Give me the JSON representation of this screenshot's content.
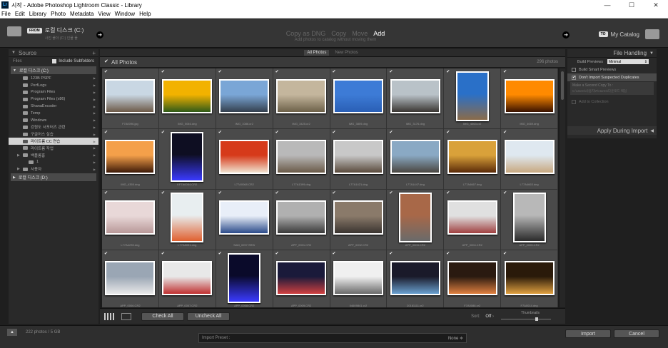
{
  "window": {
    "title": "시작 - Adobe Photoshop Lightroom Classic - Library",
    "app_icon": "Lr",
    "minimize": "—",
    "maximize": "☐",
    "close": "✕"
  },
  "menu": [
    "File",
    "Edit",
    "Library",
    "Photo",
    "Metadata",
    "View",
    "Window",
    "Help"
  ],
  "header": {
    "from_badge": "FROM",
    "source_name": "로컬 디스크 (C:)",
    "source_sub": "사진 폴더 (C:) 인물 폴",
    "modes": [
      "Copy as DNG",
      "Copy",
      "Move",
      "Add"
    ],
    "active_mode": "Add",
    "mode_desc": "Add photos to catalog without moving them",
    "to_badge": "TO",
    "catalog": "My Catalog"
  },
  "source_panel": {
    "title": "Source",
    "plus": "+",
    "files_label": "Files",
    "include_subfolders": "Include Subfolders",
    "volume_c": "로컬 디스크 (C:)",
    "volume_d": "로컬 디스크 (D:)",
    "folders": [
      {
        "name": "123B PSPF",
        "level": 1
      },
      {
        "name": "PerfLogs",
        "level": 1
      },
      {
        "name": "Program Files",
        "level": 1
      },
      {
        "name": "Program Files (x86)",
        "level": 1
      },
      {
        "name": "ShanaEncoder",
        "level": 1
      },
      {
        "name": "Temp",
        "level": 1
      },
      {
        "name": "Windows",
        "level": 1
      },
      {
        "name": "강원도 서포터즈 관련",
        "level": 1
      },
      {
        "name": "구글어스 실습",
        "level": 1
      },
      {
        "name": "라이트룸 CC 연습",
        "level": 1,
        "selected": true
      },
      {
        "name": "라이트룸 작업",
        "level": 1
      },
      {
        "name": "백플롱홍",
        "level": 1
      },
      {
        "name": "1",
        "level": 2
      },
      {
        "name": "사용자",
        "level": 1
      }
    ]
  },
  "grid": {
    "filters": [
      "All Photos",
      "New Photos"
    ],
    "active_filter": "All Photos",
    "title": "All Photos",
    "count": "296 photos",
    "photos": [
      {
        "name": "F7A0096.jpg",
        "orient": "land",
        "colors": [
          "#c9d7e3",
          "#6d5a48"
        ]
      },
      {
        "name": "IMG_0046.dng",
        "orient": "land",
        "colors": [
          "#f2b200",
          "#2f5a18"
        ]
      },
      {
        "name": "IMG_1086.cr2",
        "orient": "land",
        "colors": [
          "#7aa6d6",
          "#34404e"
        ]
      },
      {
        "name": "IMG_3425.cr2",
        "orient": "land",
        "colors": [
          "#c4b69d",
          "#6d6149"
        ]
      },
      {
        "name": "IMG_3809.dng",
        "orient": "land",
        "colors": [
          "#3d7bd6",
          "#2a5fb5"
        ]
      },
      {
        "name": "IMG_3176.dng",
        "orient": "land",
        "colors": [
          "#b9c2c8",
          "#3a3632"
        ]
      },
      {
        "name": "IMG_4063.cr2",
        "orient": "port",
        "colors": [
          "#2a70c8",
          "#8a6b4a"
        ]
      },
      {
        "name": "IMG_4069.dng",
        "orient": "land",
        "colors": [
          "#ff8a00",
          "#3a1200"
        ]
      },
      {
        "name": "IMG_4355.dng",
        "orient": "land",
        "colors": [
          "#f4a04a",
          "#3d1a08"
        ]
      },
      {
        "name": "KF7A0054.CR2",
        "orient": "port",
        "colors": [
          "#0e0e22",
          "#3a3aff"
        ]
      },
      {
        "name": "L77A0068.CR2",
        "orient": "land",
        "colors": [
          "#d63a1a",
          "#f0e2d0"
        ]
      },
      {
        "name": "L77A1399.dng",
        "orient": "land",
        "colors": [
          "#b9b9b9",
          "#6a5a48"
        ]
      },
      {
        "name": "L77A1421.dng",
        "orient": "land",
        "colors": [
          "#c8c8c8",
          "#5a4a3c"
        ]
      },
      {
        "name": "L77A1447.dng",
        "orient": "land",
        "colors": [
          "#8aa9c4",
          "#4a4640"
        ]
      },
      {
        "name": "L77A4667.dng",
        "orient": "land",
        "colors": [
          "#d9a13a",
          "#5a2a08"
        ]
      },
      {
        "name": "L77A4663.dng",
        "orient": "land",
        "colors": [
          "#dfe8f0",
          "#c8a880"
        ]
      },
      {
        "name": "L77A4235.dng",
        "orient": "land",
        "colors": [
          "#e8d8d8",
          "#b89898"
        ]
      },
      {
        "name": "L77A5051.dng",
        "orient": "port",
        "colors": [
          "#e8eef0",
          "#e06030"
        ]
      },
      {
        "name": "SAM_0297.SRW",
        "orient": "land",
        "colors": [
          "#e8eef8",
          "#2a4a8a"
        ]
      },
      {
        "name": "APP_0001.CR2",
        "orient": "land",
        "colors": [
          "#b0b0b0",
          "#3a3a3a"
        ]
      },
      {
        "name": "APP_0002.CR2",
        "orient": "land",
        "colors": [
          "#8a7a6a",
          "#3a3430"
        ]
      },
      {
        "name": "APP_0003.CR2",
        "orient": "port",
        "colors": [
          "#a86848",
          "#6a6a6a"
        ]
      },
      {
        "name": "APP_0004.CR2",
        "orient": "land",
        "colors": [
          "#e0e0e0",
          "#a04040"
        ]
      },
      {
        "name": "APP_0005.CR2",
        "orient": "port",
        "colors": [
          "#b8b8b8",
          "#2a2a2a"
        ]
      },
      {
        "name": "APP_0006.CR2",
        "orient": "land",
        "colors": [
          "#9aa6b4",
          "#e8e8e8"
        ]
      },
      {
        "name": "APP_0007.CR2",
        "orient": "land",
        "colors": [
          "#e8e8e8",
          "#c03030"
        ]
      },
      {
        "name": "APP_0008.CR2",
        "orient": "port",
        "colors": [
          "#0a0a2a",
          "#3a3aff"
        ]
      },
      {
        "name": "APP_0009.CR2",
        "orient": "land",
        "colors": [
          "#1a1a3a",
          "#d04040"
        ]
      },
      {
        "name": "04609841.cr2",
        "orient": "land",
        "colors": [
          "#f0f0f0",
          "#6a6a6a"
        ]
      },
      {
        "name": "20181111.cr2",
        "orient": "land",
        "colors": [
          "#1a1a2a",
          "#6aa0d0"
        ]
      },
      {
        "name": "F7A0088.cr2",
        "orient": "land",
        "colors": [
          "#2a1a10",
          "#e08040"
        ]
      },
      {
        "name": "F7A0014.dng",
        "orient": "land",
        "colors": [
          "#2a1a0a",
          "#e0a040"
        ]
      }
    ]
  },
  "toolbar": {
    "check_all": "Check All",
    "uncheck_all": "Uncheck All",
    "sort_label": "Sort:",
    "sort_value": "Off",
    "thumbnails_label": "Thumbnails"
  },
  "file_handling": {
    "title": "File Handling",
    "build_previews_label": "Build Previews",
    "build_previews_value": "Minimal",
    "build_smart_previews": "Build Smart Previews",
    "dont_import_duplicates": "Don't Import Suspected Duplicates",
    "make_second_copy": "Make a Second Copy To :",
    "second_copy_path": "C:\\Users\\사용자\\Pictures\\다운로드 백업",
    "add_to_collection": "Add to Collection",
    "apply_during_import": "Apply During Import"
  },
  "footer": {
    "up_arrow": "▲",
    "info": "222 photos / 5 GB",
    "import_preset_label": "Import Preset :",
    "import_preset_value": "None ≑",
    "import_button": "Import",
    "cancel_button": "Cancel"
  }
}
